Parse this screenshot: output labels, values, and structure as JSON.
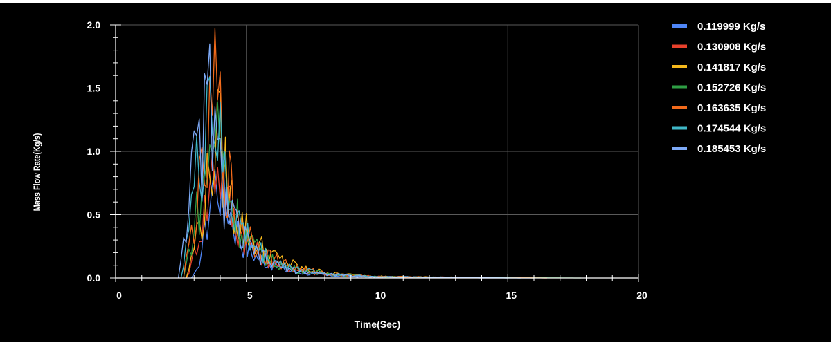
{
  "chart_data": {
    "type": "line",
    "title": "",
    "xlabel": "Time(Sec)",
    "ylabel": "Mass Flow Rate(Kg/s)",
    "xlim": [
      0,
      20
    ],
    "ylim": [
      0,
      2.0
    ],
    "x_ticks": [
      "0",
      "5",
      "10",
      "15",
      "20"
    ],
    "y_ticks": [
      "0.0",
      "0.5",
      "1.0",
      "1.5",
      "2.0"
    ],
    "grid": true,
    "legend_position": "top-right",
    "background": "#000000",
    "series": [
      {
        "name": "0.119999 Kg/s",
        "color": "#4f86f7",
        "x": [
          2.9,
          3.1,
          3.3,
          3.5,
          3.7,
          3.9,
          4.1,
          4.3,
          4.5,
          4.8,
          5.2,
          5.8,
          6.5,
          7.5,
          9.0,
          11.0,
          14.0,
          16.0
        ],
        "y": [
          0.0,
          0.05,
          0.25,
          0.45,
          0.75,
          0.8,
          0.7,
          0.6,
          0.45,
          0.3,
          0.2,
          0.12,
          0.06,
          0.03,
          0.01,
          0.005,
          0.0,
          0.0
        ]
      },
      {
        "name": "0.130908 Kg/s",
        "color": "#e8412c",
        "x": [
          2.7,
          2.9,
          3.1,
          3.3,
          3.5,
          3.7,
          3.9,
          4.1,
          4.3,
          4.6,
          5.0,
          5.5,
          6.2,
          7.2,
          8.5,
          10.5,
          13.5,
          16.5
        ],
        "y": [
          0.0,
          0.1,
          0.3,
          0.45,
          0.6,
          0.85,
          0.95,
          0.8,
          0.6,
          0.42,
          0.3,
          0.18,
          0.1,
          0.05,
          0.02,
          0.01,
          0.005,
          0.0
        ]
      },
      {
        "name": "0.141817 Kg/s",
        "color": "#f5b81c",
        "x": [
          2.7,
          2.9,
          3.1,
          3.3,
          3.5,
          3.7,
          3.9,
          4.1,
          4.3,
          4.6,
          5.0,
          5.5,
          6.2,
          7.2,
          8.5,
          10.5,
          13.5,
          16.0
        ],
        "y": [
          0.0,
          0.15,
          0.35,
          0.5,
          0.7,
          1.0,
          1.1,
          0.95,
          0.7,
          0.5,
          0.38,
          0.25,
          0.15,
          0.07,
          0.03,
          0.01,
          0.005,
          0.0
        ]
      },
      {
        "name": "0.152726 Kg/s",
        "color": "#2e9e44",
        "x": [
          2.6,
          2.8,
          3.0,
          3.2,
          3.4,
          3.6,
          3.8,
          4.0,
          4.2,
          4.5,
          4.9,
          5.4,
          6.0,
          7.0,
          8.3,
          10.0,
          13.0,
          17.8
        ],
        "y": [
          0.0,
          0.2,
          0.4,
          0.6,
          0.75,
          1.0,
          1.2,
          1.05,
          0.8,
          0.55,
          0.35,
          0.22,
          0.13,
          0.06,
          0.03,
          0.01,
          0.005,
          0.0
        ]
      },
      {
        "name": "0.163635 Kg/s",
        "color": "#f26a1b",
        "x": [
          2.6,
          2.8,
          3.0,
          3.2,
          3.4,
          3.6,
          3.8,
          4.0,
          4.2,
          4.5,
          4.9,
          5.4,
          6.0,
          7.0,
          8.3,
          10.0,
          13.0,
          16.5
        ],
        "y": [
          0.0,
          0.25,
          0.45,
          0.65,
          0.8,
          1.1,
          1.5,
          1.2,
          0.85,
          0.6,
          0.4,
          0.25,
          0.15,
          0.07,
          0.03,
          0.01,
          0.005,
          0.0
        ]
      },
      {
        "name": "0.174544 Kg/s",
        "color": "#3fb8c8",
        "x": [
          2.5,
          2.7,
          2.9,
          3.1,
          3.3,
          3.5,
          3.7,
          3.9,
          4.1,
          4.4,
          4.8,
          5.3,
          5.9,
          6.9,
          8.2,
          10.0,
          13.0,
          15.5
        ],
        "y": [
          0.0,
          0.3,
          0.55,
          0.8,
          0.9,
          1.62,
          1.35,
          1.1,
          0.85,
          0.6,
          0.4,
          0.25,
          0.15,
          0.07,
          0.03,
          0.01,
          0.005,
          0.0
        ]
      },
      {
        "name": "0.185453 Kg/s",
        "color": "#7eaaf7",
        "x": [
          2.4,
          2.6,
          2.8,
          3.0,
          3.2,
          3.4,
          3.6,
          3.8,
          4.0,
          4.3,
          4.7,
          5.2,
          5.8,
          6.8,
          8.0,
          9.8,
          12.5,
          15.0
        ],
        "y": [
          0.0,
          0.35,
          0.6,
          0.85,
          0.95,
          1.2,
          1.45,
          1.1,
          0.8,
          0.55,
          0.35,
          0.22,
          0.13,
          0.06,
          0.03,
          0.01,
          0.005,
          0.0
        ]
      }
    ]
  }
}
